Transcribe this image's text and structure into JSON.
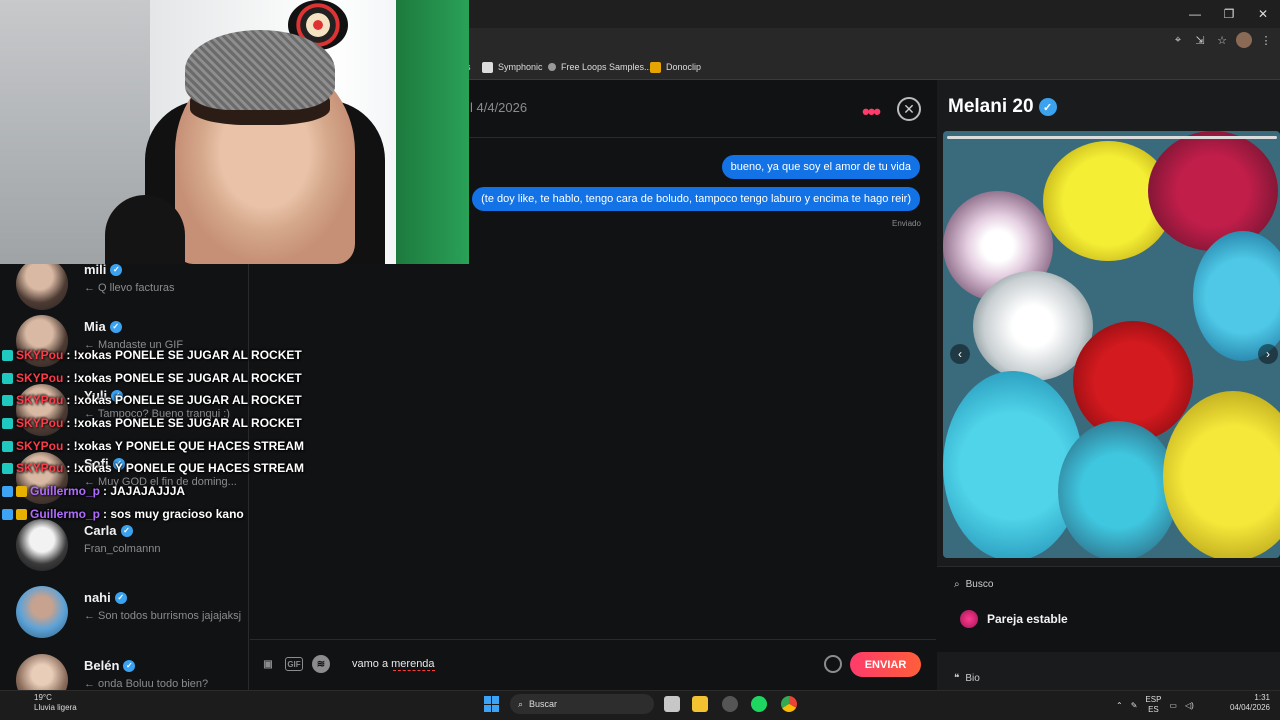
{
  "browser": {
    "bookmarks": [
      {
        "label": "s",
        "icon": "bookmark-icon"
      },
      {
        "label": "Symphonic",
        "icon": "symphonic-icon"
      },
      {
        "label": "Free Loops Samples...",
        "icon": "loops-icon"
      },
      {
        "label": "Donoclip",
        "icon": "donoclip-icon"
      }
    ]
  },
  "conversations": [
    {
      "name": "mili",
      "preview": "← Q llevo facturas"
    },
    {
      "name": "Mia",
      "preview": "← Mandaste un GIF"
    },
    {
      "name": "Yuli",
      "preview": "← Tampoco? Bueno tranqui :)"
    },
    {
      "name": "Sofi",
      "preview": "← Muy GOD el fin de doming..."
    },
    {
      "name": "Carla",
      "preview": "Fran_colmannn"
    },
    {
      "name": "nahi",
      "preview": "← Son todos burrismos jajajaksj"
    },
    {
      "name": "Belén",
      "preview": "← onda Boluu todo bien?"
    }
  ],
  "stream_chat": [
    {
      "user": "SKYPou",
      "message": ": !xokas PONELE SE JUGAR AL ROCKET",
      "color": "#ff3b4a"
    },
    {
      "user": "SKYPou",
      "message": ": !xokas PONELE SE JUGAR AL ROCKET",
      "color": "#ff3b4a"
    },
    {
      "user": "SKYPou",
      "message": ": !xokas PONELE SE JUGAR AL ROCKET",
      "color": "#ff3b4a"
    },
    {
      "user": "SKYPou",
      "message": ": !xokas PONELE SE JUGAR AL ROCKET",
      "color": "#ff3b4a"
    },
    {
      "user": "SKYPou",
      "message": ": !xokas Y PONELE QUE HACES STREAM",
      "color": "#ff3b4a"
    },
    {
      "user": "SKYPou",
      "message": ": !xokas Y PONELE QUE HACES STREAM",
      "color": "#ff3b4a"
    },
    {
      "user": "Guillermo_p",
      "message": ": JAJAJAJJJA",
      "color": "#b16bff"
    },
    {
      "user": "Guillermo_p",
      "message": ": sos muy gracioso kano",
      "color": "#b16bff"
    }
  ],
  "thread": {
    "date": "l 4/4/2026",
    "messages": [
      {
        "text": "bueno, ya que soy el amor de tu vida"
      },
      {
        "text": "(te doy like, te hablo, tengo cara de boludo, tampoco tengo laburo y encima te hago reir)"
      }
    ],
    "status": "Enviado"
  },
  "composer": {
    "value": "vamo a merenda",
    "gif_label": "GIF",
    "send_label": "ENVIAR"
  },
  "profile": {
    "name": "Melani 20",
    "busco_label": "Busco",
    "looking_for": "Pareja estable",
    "bio_label": "Bio"
  },
  "taskbar": {
    "temperature": "19°C",
    "weather": "Lluvia ligera",
    "search_placeholder": "Buscar",
    "lang_top": "ESP",
    "lang_bottom": "ES",
    "time": "1:31",
    "date": "04/04/2026"
  },
  "colors": {
    "accent": "#ff3b6b",
    "bubble": "#1272e6",
    "verified": "#3ba2f0"
  }
}
